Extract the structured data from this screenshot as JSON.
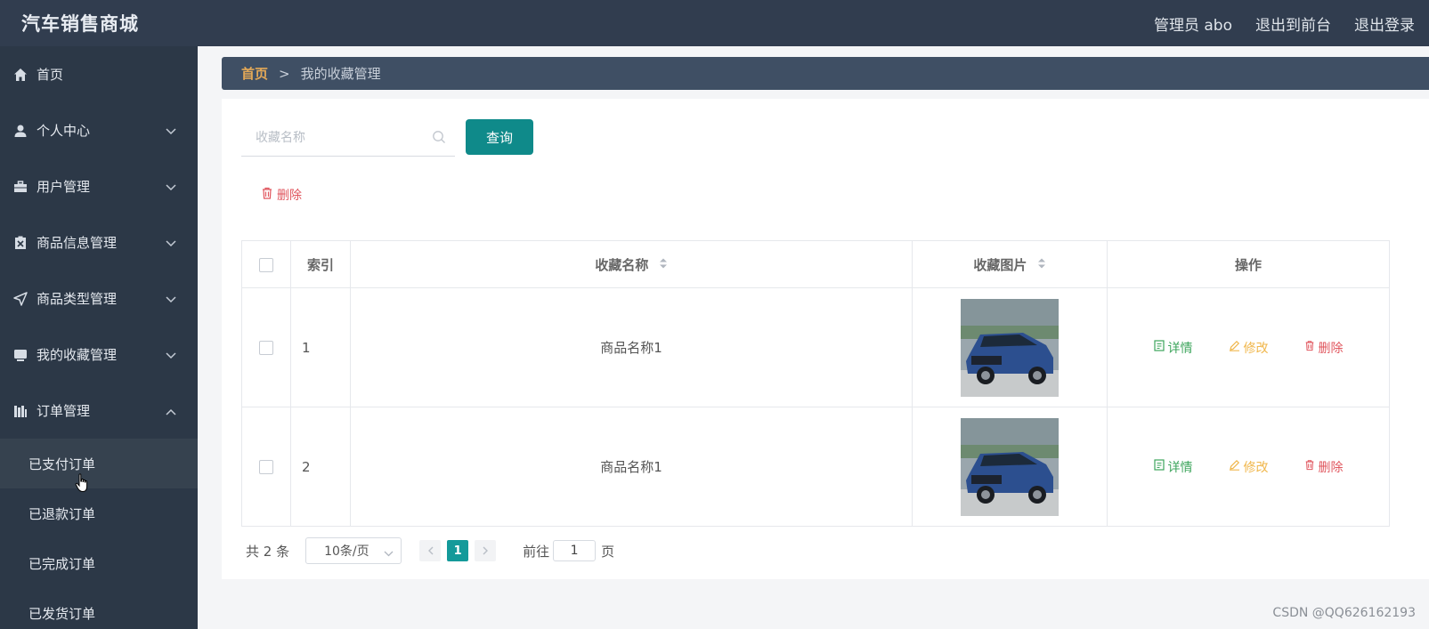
{
  "header": {
    "brand": "汽车销售商城",
    "links": [
      "管理员 abo",
      "退出到前台",
      "退出登录"
    ]
  },
  "sidebar": {
    "items": [
      {
        "label": "首页",
        "icon": "home-icon",
        "has_arrow": false
      },
      {
        "label": "个人中心",
        "icon": "user-icon",
        "has_arrow": true
      },
      {
        "label": "用户管理",
        "icon": "briefcase-icon",
        "has_arrow": true
      },
      {
        "label": "商品信息管理",
        "icon": "clipboard-icon",
        "has_arrow": true
      },
      {
        "label": "商品类型管理",
        "icon": "send-icon",
        "has_arrow": true
      },
      {
        "label": "我的收藏管理",
        "icon": "monitor-icon",
        "has_arrow": true
      },
      {
        "label": "订单管理",
        "icon": "books-icon",
        "has_arrow": true,
        "expanded": true
      }
    ],
    "subitems": [
      {
        "label": "已支付订单",
        "active": true
      },
      {
        "label": "已退款订单"
      },
      {
        "label": "已完成订单"
      },
      {
        "label": "已发货订单"
      }
    ]
  },
  "breadcrumb": {
    "home": "首页",
    "separator": ">",
    "current": "我的收藏管理"
  },
  "search": {
    "placeholder": "收藏名称",
    "button": "查询"
  },
  "toolbar": {
    "delete_label": "删除"
  },
  "table": {
    "headers": {
      "index": "索引",
      "name": "收藏名称",
      "image": "收藏图片",
      "actions": "操作"
    },
    "rows": [
      {
        "index": "1",
        "name": "商品名称1"
      },
      {
        "index": "2",
        "name": "商品名称1"
      }
    ],
    "actions": {
      "detail": "详情",
      "edit": "修改",
      "delete": "删除"
    }
  },
  "pagination": {
    "total": "共 2 条",
    "page_size": "10条/页",
    "current_page": "1",
    "goto_prefix": "前往",
    "goto_value": "1",
    "goto_suffix": "页"
  },
  "watermark": "CSDN @QQ626162193",
  "colors": {
    "header_bg": "#313d4f",
    "sidebar_bg": "#2c3847",
    "accent": "#0f8a8a",
    "breadcrumb_home": "#e3a857",
    "detail": "#3da55c",
    "edit": "#f0b64a",
    "delete": "#e0565e"
  }
}
